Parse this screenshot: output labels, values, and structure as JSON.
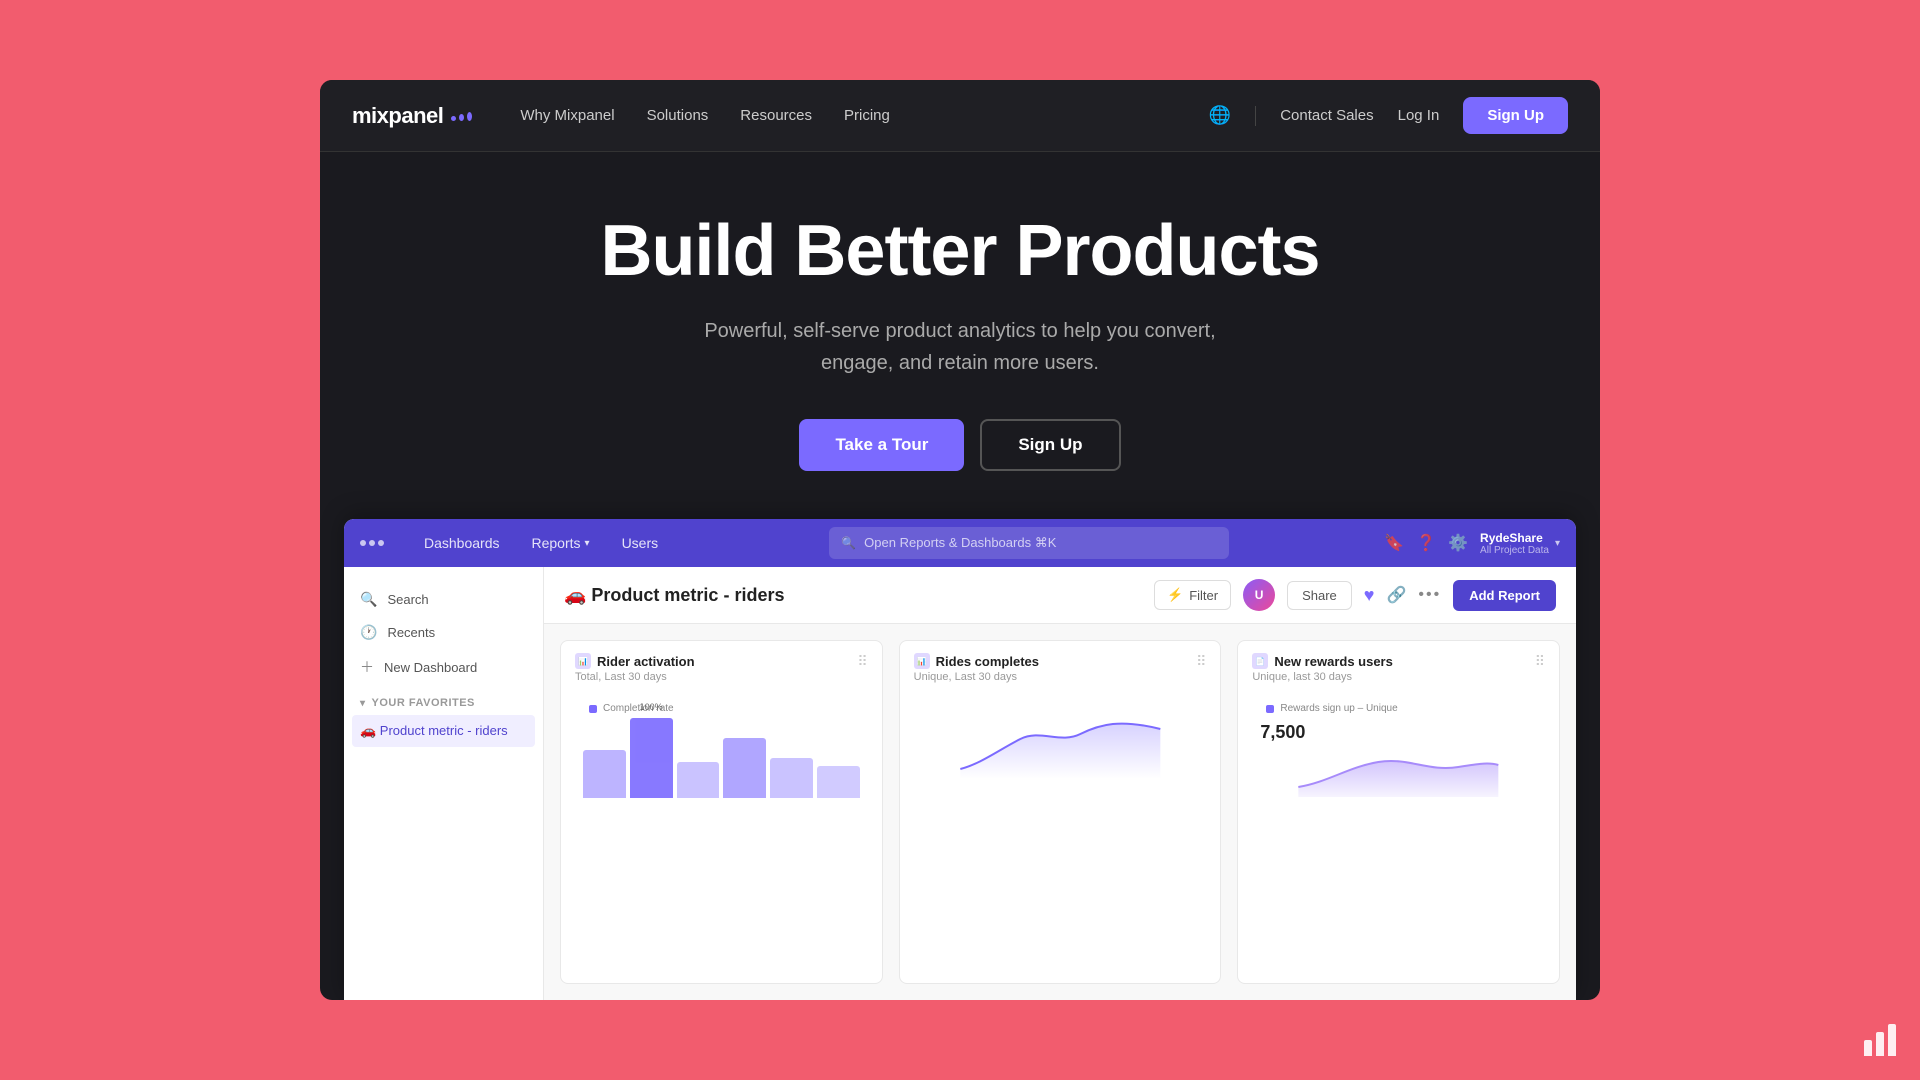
{
  "nav": {
    "logo_text": "mixpanel",
    "links": [
      "Why Mixpanel",
      "Solutions",
      "Resources",
      "Pricing"
    ],
    "contact": "Contact Sales",
    "login": "Log In",
    "signup": "Sign Up"
  },
  "hero": {
    "title": "Build Better Products",
    "subtitle": "Powerful, self-serve product analytics to help you convert,\nengage, and retain more users.",
    "btn_tour": "Take a Tour",
    "btn_signup": "Sign Up"
  },
  "app": {
    "nav": {
      "dashboards": "Dashboards",
      "reports": "Reports",
      "users": "Users",
      "search_placeholder": "Open Reports &  Dashboards ⌘K",
      "org_name": "RydeShare",
      "org_sub": "All Project Data"
    },
    "sidebar": {
      "search": "Search",
      "recents": "Recents",
      "new_dashboard": "New Dashboard",
      "favorites_label": "Your Favorites",
      "active_item": "🚗 Product metric - riders"
    },
    "main": {
      "title": "🚗 Product metric - riders",
      "filter_btn": "Filter",
      "share_btn": "Share",
      "add_report_btn": "Add Report",
      "cards": [
        {
          "title": "Rider activation",
          "subtitle": "Total, Last 30 days",
          "legend": "Completion rate",
          "bars": [
            60,
            100,
            45,
            75,
            50,
            40
          ],
          "bar_label": "100%"
        },
        {
          "title": "Rides completes",
          "subtitle": "Unique, Last 30 days",
          "legend": "",
          "type": "line"
        },
        {
          "title": "New rewards users",
          "subtitle": "Unique, last 30 days",
          "legend": "Rewards sign up – Unique",
          "value": "7,500",
          "type": "area"
        }
      ]
    }
  }
}
